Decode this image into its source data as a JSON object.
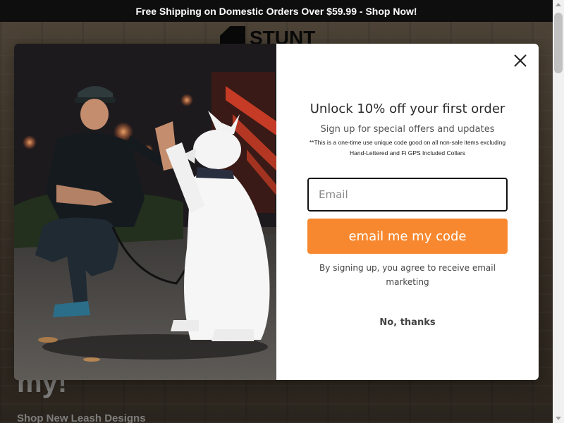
{
  "announcement": {
    "text": "Free Shipping on Domestic Orders Over $59.99 - Shop Now!"
  },
  "background_page": {
    "logo_text": "STUNT",
    "hero_heading": "my!",
    "hero_subtext": "Shop New Leash Designs"
  },
  "popup": {
    "close_icon": "close-icon",
    "title": "Unlock 10% off your first order",
    "subtitle": "Sign up for special offers and updates",
    "fine_print": "**This is a one-time use unique code good on all non-sale items excluding Hand-Lettered and Fi GPS Included Collars",
    "email_placeholder": "Email",
    "email_value": "",
    "submit_label": "email me my code",
    "consent_text": "By signing up, you agree to receive email marketing",
    "dismiss_label": "No, thanks",
    "image_alt": "Woman in cap high-fiving a white dog at night"
  },
  "colors": {
    "announcement_bg": "#0e0e0e",
    "accent": "#f7882f",
    "input_border": "#111111",
    "title_text": "#2b2b2b"
  }
}
